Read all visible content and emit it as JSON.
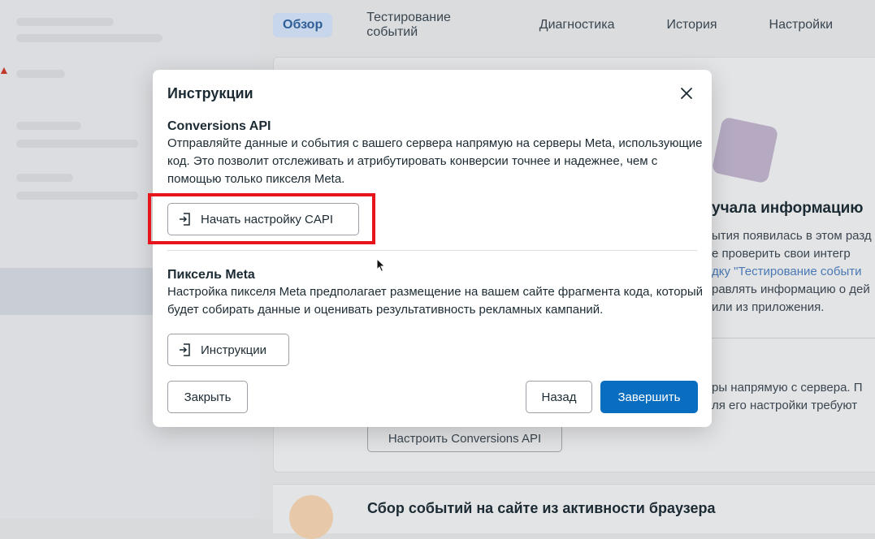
{
  "tabs": [
    {
      "label": "Обзор",
      "active": true
    },
    {
      "label": "Тестирование событий"
    },
    {
      "label": "Диагностика"
    },
    {
      "label": "История"
    },
    {
      "label": "Настройки"
    }
  ],
  "background": {
    "heading": "учала информацию",
    "lines": [
      "ытия появилась в этом разд",
      "е проверить свои интегр",
      "дку \"Тестирование событи",
      "равлять информацию о дей",
      "или из приложения."
    ],
    "server_lines": [
      "ры напрямую с сервера. П",
      "ля его настройки требуют"
    ],
    "setup_capi_button": "Настроить Conversions API",
    "browser_events_title": "Сбор событий на сайте из активности браузера"
  },
  "modal": {
    "title": "Инструкции",
    "close_icon": "close-icon",
    "capi": {
      "title": "Conversions API",
      "description": "Отправляйте данные и события с вашего сервера напрямую на серверы Meta, использующие код. Это позволит отслеживать и атрибутировать конверсии точнее и надежнее, чем с помощью только пикселя Meta.",
      "button_label": "Начать настройку CAPI",
      "button_icon": "sign-in-icon"
    },
    "pixel": {
      "title": "Пиксель Meta",
      "description": "Настройка пикселя Meta предполагает размещение на вашем сайте фрагмента кода, который будет собирать данные и оценивать результативность рекламных кампаний.",
      "button_label": "Инструкции",
      "button_icon": "sign-in-icon"
    },
    "footer": {
      "close_label": "Закрыть",
      "back_label": "Назад",
      "finish_label": "Завершить"
    }
  },
  "colors": {
    "primary": "#0a6ec0",
    "highlight": "#e8141c",
    "active_tab_text": "#2f5e98"
  }
}
